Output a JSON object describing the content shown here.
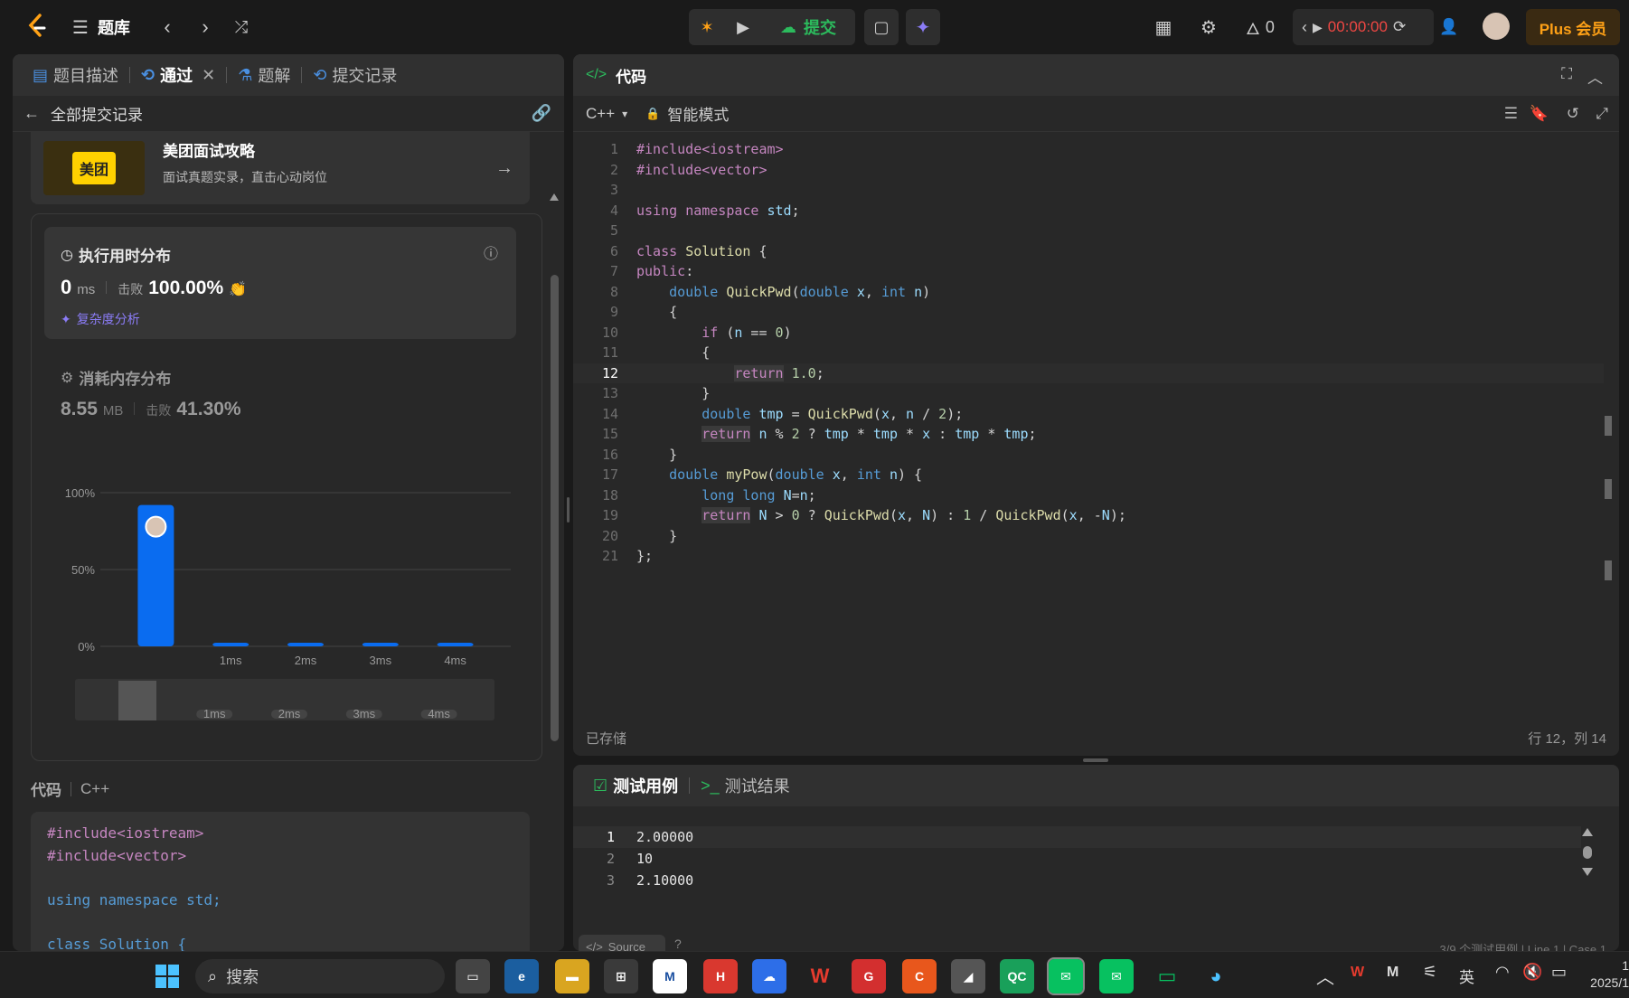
{
  "topbar": {
    "problem_bank": "题库",
    "submit_label": "提交",
    "streak_count": "0",
    "timer": "00:00:00",
    "plus_label": "Plus 会员"
  },
  "left": {
    "tabs": [
      {
        "label": "题目描述"
      },
      {
        "label": "通过"
      },
      {
        "label": "题解"
      },
      {
        "label": "提交记录"
      }
    ],
    "back_label": "全部提交记录",
    "promo": {
      "logo_text": "美团",
      "title": "美团面试攻略",
      "subtitle": "面试真题实录，直击心动岗位"
    },
    "runtime": {
      "title": "执行用时分布",
      "value": "0",
      "unit": "ms",
      "beat_label": "击败",
      "beat_value": "100.00%",
      "analysis_label": "复杂度分析"
    },
    "memory": {
      "title": "消耗内存分布",
      "value": "8.55",
      "unit": "MB",
      "beat_label": "击败",
      "beat_value": "41.30%"
    },
    "code_header": {
      "label": "代码",
      "lang": "C++"
    },
    "code_preview": [
      "#include<iostream>",
      "#include<vector>",
      "",
      "using namespace std;",
      "",
      "class Solution {"
    ]
  },
  "chart_data": {
    "type": "bar",
    "categories": [
      "",
      "1ms",
      "2ms",
      "3ms",
      "4ms"
    ],
    "values": [
      92,
      2,
      2,
      2,
      2
    ],
    "yticks": [
      "100%",
      "50%",
      "0%"
    ],
    "ylim": [
      0,
      100
    ],
    "mini_labels": [
      "1ms",
      "2ms",
      "3ms",
      "4ms"
    ]
  },
  "editor": {
    "title": "代码",
    "language": "C++",
    "mode": "智能模式",
    "status_saved": "已存储",
    "cursor_pos": "行 12，列 14",
    "lines": [
      "#include<iostream>",
      "#include<vector>",
      "",
      "using namespace std;",
      "",
      "class Solution {",
      "public:",
      "    double QuickPwd(double x, int n)",
      "    {",
      "        if (n == 0)",
      "        {",
      "            return 1.0;",
      "        }",
      "        double tmp = QuickPwd(x, n / 2);",
      "        return n % 2 ? tmp * tmp * x : tmp * tmp;",
      "    }",
      "    double myPow(double x, int n) {",
      "        long long N=n;",
      "        return N > 0 ? QuickPwd(x, N) : 1 / QuickPwd(x, -N);",
      "    }",
      "};"
    ],
    "line_numbers": [
      "1",
      "2",
      "3",
      "4",
      "5",
      "6",
      "7",
      "8",
      "9",
      "10",
      "11",
      "12",
      "13",
      "14",
      "15",
      "16",
      "17",
      "18",
      "19",
      "20",
      "21"
    ]
  },
  "tests": {
    "tab_cases": "测试用例",
    "tab_results": "测试结果",
    "lines": [
      "2.00000",
      "10",
      "2.10000"
    ],
    "line_numbers": [
      "1",
      "2",
      "3"
    ],
    "source_label": "Source",
    "footer_right": "3/9 个测试用例 | Line 1 | Case 1"
  },
  "taskbar": {
    "search_placeholder": "搜索",
    "ime": "英",
    "clock_line1": "1",
    "clock_line2": "2025/1"
  }
}
